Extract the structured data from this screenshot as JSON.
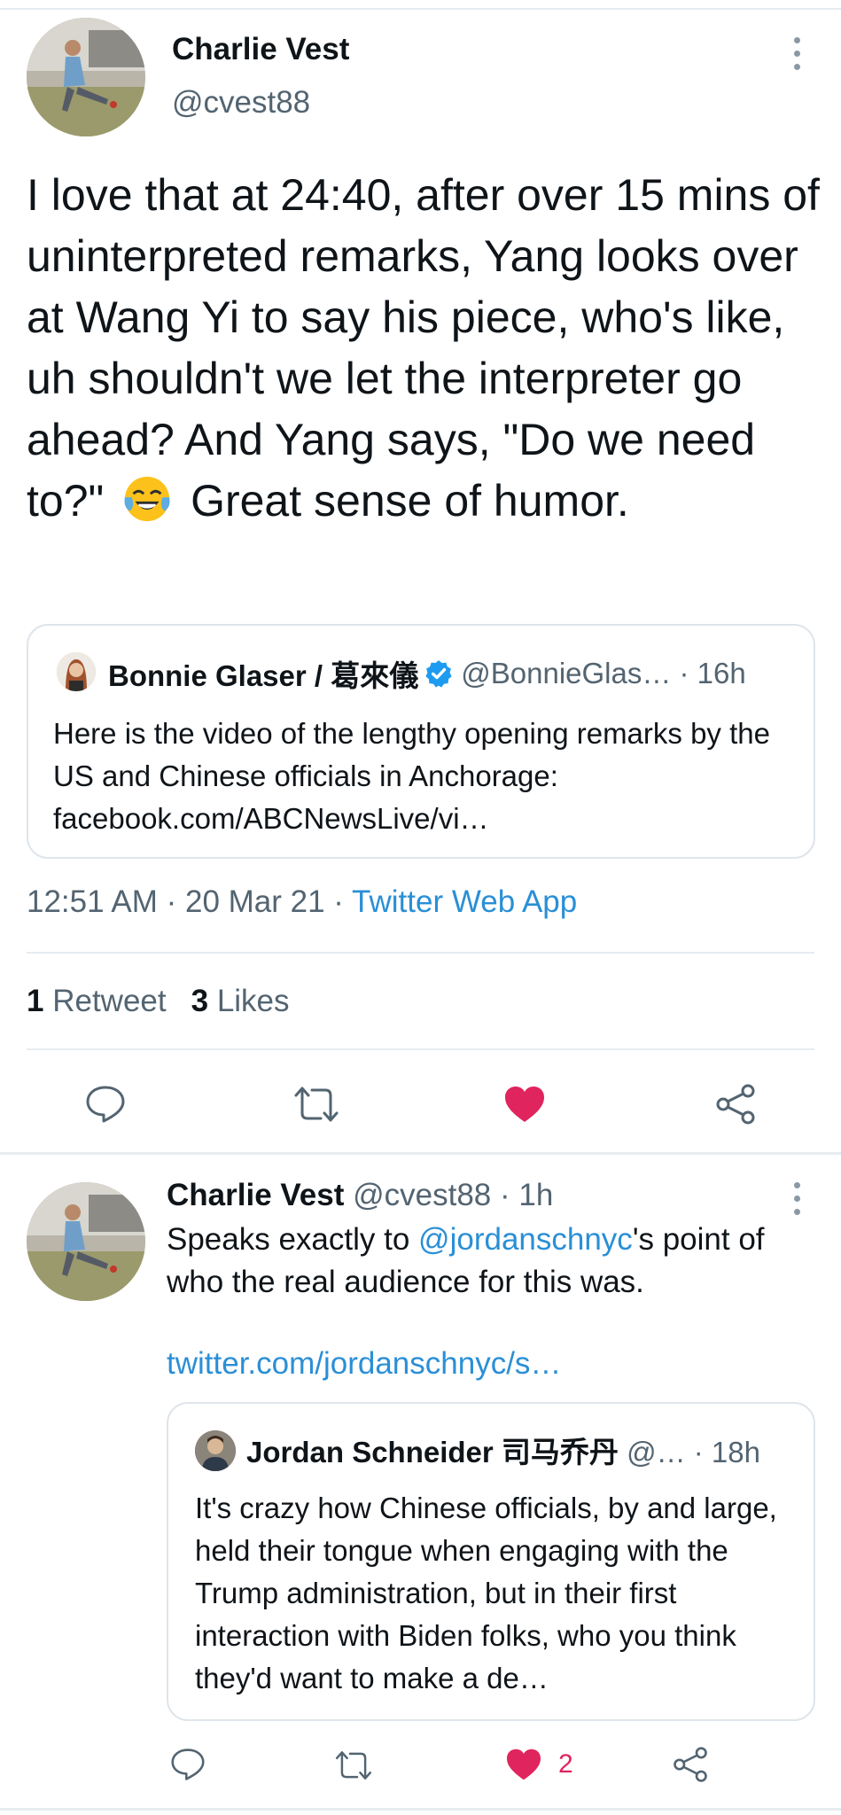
{
  "main_tweet": {
    "author_name": "Charlie Vest",
    "handle": "@cvest88",
    "text_before_emoji": "I love that at 24:40, after over 15 mins of uninterpreted remarks, Yang looks over at Wang Yi to say his piece, who's like, uh shouldn't we let the interpreter go ahead? And Yang says, \"Do we need to?\"",
    "emoji": "face-with-tears-of-joy",
    "text_after_emoji": "Great sense of humor.",
    "quote": {
      "author_name": "Bonnie Glaser / 葛來儀",
      "handle_and_time": "@BonnieGlas… · 16h",
      "text": "Here is the video of the lengthy opening remarks by the US and Chinese officials in Anchorage: facebook.com/ABCNewsLive/vi…"
    },
    "timestamp": "12:51 AM · 20 Mar 21 · ",
    "source_app": "Twitter Web App",
    "stats": {
      "retweet_count": "1",
      "retweet_label": "Retweet",
      "like_count": "3",
      "like_label": "Likes"
    }
  },
  "reply_tweet": {
    "author_name": "Charlie Vest",
    "meta": "@cvest88 · 1h",
    "text_part1": "Speaks exactly to ",
    "mention": "@jordanschnyc",
    "text_part2": "'s point of who the real audience for this was.",
    "link": "twitter.com/jordanschnyc/s…",
    "quote": {
      "author_name": "Jordan Schneider 司马乔丹",
      "meta": "@… · 18h",
      "text": "It's crazy how Chinese officials, by and large, held their tongue when engaging with the Trump administration, but in their first interaction with Biden folks, who you think they'd want to make a de…"
    },
    "like_count": "2"
  },
  "colors": {
    "accent": "#2a8fd6",
    "like": "#e0245e",
    "secondary_text": "#536471"
  }
}
